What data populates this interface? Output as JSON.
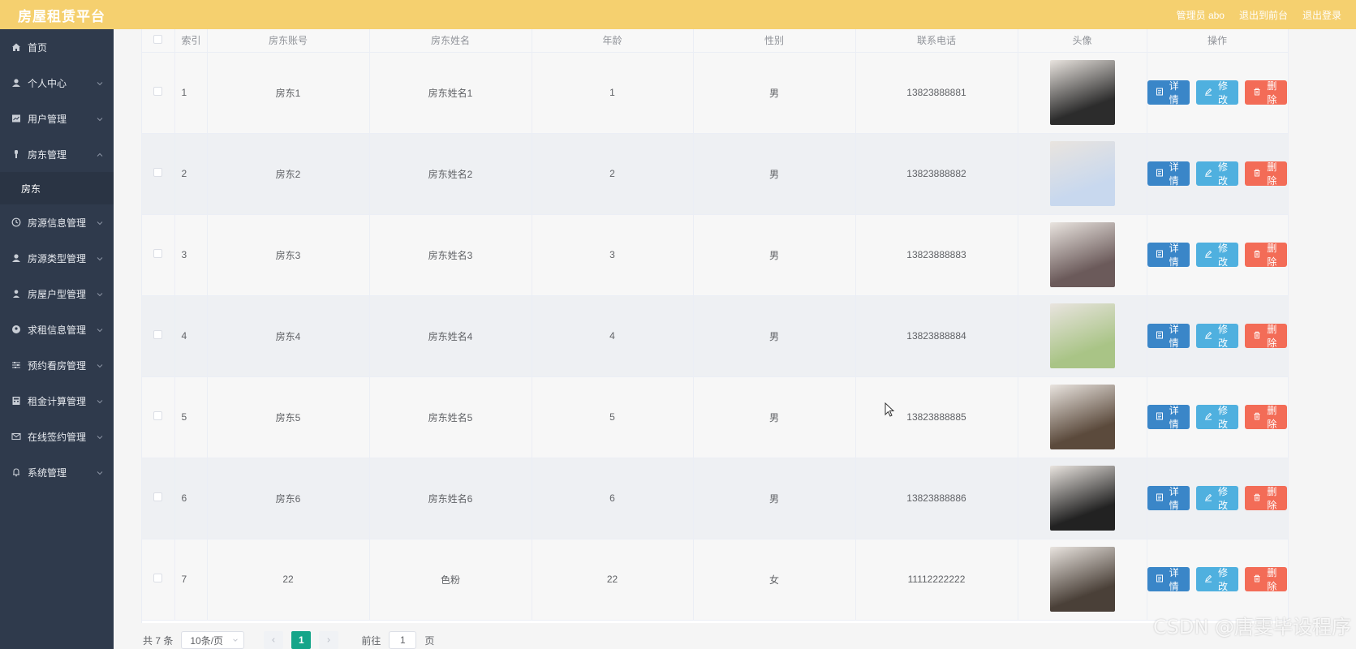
{
  "header": {
    "title": "房屋租赁平台",
    "admin_label": "管理员 abo",
    "to_front": "退出到前台",
    "logout": "退出登录"
  },
  "sidebar": {
    "items": [
      {
        "label": "首页",
        "icon": "home-icon"
      },
      {
        "label": "个人中心",
        "icon": "user-icon"
      },
      {
        "label": "用户管理",
        "icon": "chart-icon"
      },
      {
        "label": "房东管理",
        "icon": "person-icon",
        "expanded": true
      },
      {
        "label": "房源信息管理",
        "icon": "clock-icon"
      },
      {
        "label": "房源类型管理",
        "icon": "user-icon"
      },
      {
        "label": "房屋户型管理",
        "icon": "person-icon"
      },
      {
        "label": "求租信息管理",
        "icon": "location-icon"
      },
      {
        "label": "预约看房管理",
        "icon": "sliders-icon"
      },
      {
        "label": "租金计算管理",
        "icon": "calc-icon"
      },
      {
        "label": "在线签约管理",
        "icon": "mail-icon"
      },
      {
        "label": "系统管理",
        "icon": "bell-icon"
      }
    ],
    "submenu": {
      "label": "房东"
    }
  },
  "table": {
    "columns": [
      "索引",
      "房东账号",
      "房东姓名",
      "年龄",
      "性别",
      "联系电话",
      "头像",
      "操作"
    ],
    "rows": [
      {
        "index": "1",
        "account": "房东1",
        "name": "房东姓名1",
        "age": "1",
        "gender": "男",
        "phone": "13823888881",
        "avatar_color": "#2c2c2c"
      },
      {
        "index": "2",
        "account": "房东2",
        "name": "房东姓名2",
        "age": "2",
        "gender": "男",
        "phone": "13823888882",
        "avatar_color": "#c8d8ee"
      },
      {
        "index": "3",
        "account": "房东3",
        "name": "房东姓名3",
        "age": "3",
        "gender": "男",
        "phone": "13823888883",
        "avatar_color": "#6b5a5a"
      },
      {
        "index": "4",
        "account": "房东4",
        "name": "房东姓名4",
        "age": "4",
        "gender": "男",
        "phone": "13823888884",
        "avatar_color": "#a9c486"
      },
      {
        "index": "5",
        "account": "房东5",
        "name": "房东姓名5",
        "age": "5",
        "gender": "男",
        "phone": "13823888885",
        "avatar_color": "#5b4a3c"
      },
      {
        "index": "6",
        "account": "房东6",
        "name": "房东姓名6",
        "age": "6",
        "gender": "男",
        "phone": "13823888886",
        "avatar_color": "#222222"
      },
      {
        "index": "7",
        "account": "22",
        "name": "色粉",
        "age": "22",
        "gender": "女",
        "phone": "11112222222",
        "avatar_color": "#4a4038"
      }
    ],
    "buttons": {
      "detail": "详情",
      "edit": "修改",
      "delete": "删除"
    }
  },
  "pagination": {
    "total_text": "共 7 条",
    "page_size": "10条/页",
    "current_page": "1",
    "goto_label": "前往",
    "goto_value": "1",
    "page_suffix": "页"
  },
  "watermark": "CSDN @唐雯毕设程序",
  "colors": {
    "header_bg": "#f5d06f",
    "sidebar_bg": "#2f3a4c",
    "detail_btn": "#3a86c8",
    "edit_btn": "#4fb0df",
    "delete_btn": "#f36c57",
    "page_active": "#15a589"
  }
}
